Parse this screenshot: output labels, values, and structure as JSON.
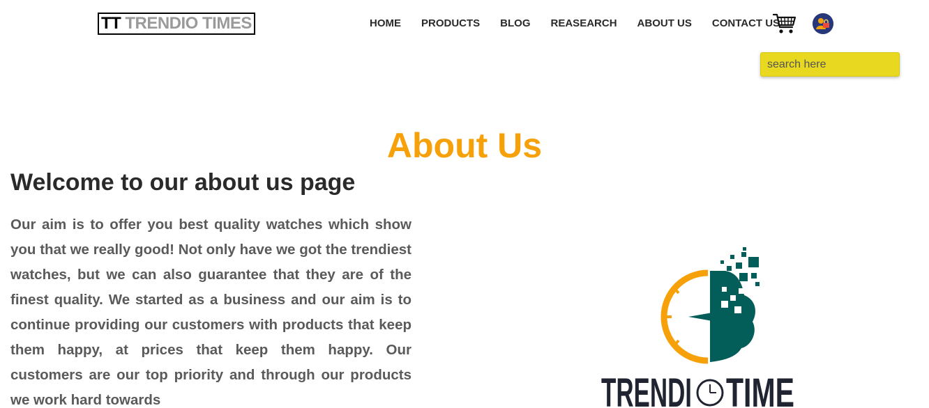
{
  "header": {
    "logo_mark": "TT",
    "logo_text": "TRENDIO TIMES",
    "nav": [
      "HOME",
      "PRODUCTS",
      "BLOG",
      "REASEARCH",
      "ABOUT US",
      "CONTACT US"
    ],
    "cart_icon": "shopping-cart-icon",
    "user_icon": "user-avatar-icon"
  },
  "search": {
    "placeholder": "search here",
    "value": ""
  },
  "main": {
    "title": "About Us",
    "heading": "Welcome to our about us page",
    "body": "Our aim is to offer you best quality watches which show you that we really good! Not only have we got the trendiest watches, but we can also guarantee that they are of the finest quality. We started as a business and our aim is to continue providing our customers with products that keep them happy, at prices that keep them happy. Our customers are our top priority and through our products we work hard towards"
  },
  "brand_logo": {
    "left_word": "TRENDI",
    "right_word": "TIME"
  },
  "colors": {
    "accent": "#f7a10a",
    "search_bg": "#e8d820",
    "logo_teal": "#035e5a",
    "logo_orange": "#f7a10a",
    "logo_dark": "#1f2430"
  }
}
